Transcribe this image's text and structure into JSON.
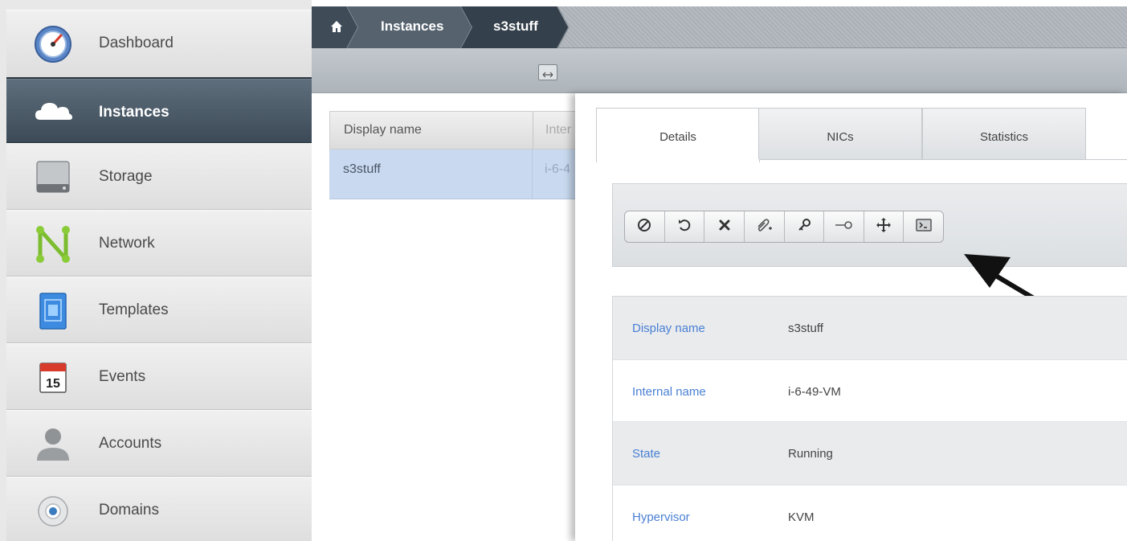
{
  "sidebar": {
    "items": [
      {
        "label": "Dashboard",
        "icon": "dashboard-gauge-icon",
        "active": false
      },
      {
        "label": "Instances",
        "icon": "cloud-icon",
        "active": true
      },
      {
        "label": "Storage",
        "icon": "hard-drive-icon",
        "active": false
      },
      {
        "label": "Network",
        "icon": "network-icon",
        "active": false
      },
      {
        "label": "Templates",
        "icon": "template-icon",
        "active": false
      },
      {
        "label": "Events",
        "icon": "calendar-icon",
        "active": false,
        "icon_text": "15"
      },
      {
        "label": "Accounts",
        "icon": "user-icon",
        "active": false
      },
      {
        "label": "Domains",
        "icon": "domain-icon",
        "active": false
      }
    ]
  },
  "breadcrumb": {
    "home_icon": "home-icon",
    "items": [
      "Instances",
      "s3stuff"
    ]
  },
  "list": {
    "columns": [
      "Display name",
      "Inter"
    ],
    "rows": [
      {
        "display_name": "s3stuff",
        "internal_name": "i-6-4"
      }
    ]
  },
  "detail": {
    "tabs": [
      "Details",
      "NICs",
      "Statistics"
    ],
    "active_tab": "Details",
    "actions": [
      {
        "name": "stop-icon"
      },
      {
        "name": "reboot-icon"
      },
      {
        "name": "destroy-icon"
      },
      {
        "name": "attach-iso-icon"
      },
      {
        "name": "reset-password-icon"
      },
      {
        "name": "change-service-offering-icon"
      },
      {
        "name": "migrate-icon"
      },
      {
        "name": "console-icon"
      }
    ],
    "fields": [
      {
        "label": "Display name",
        "value": "s3stuff"
      },
      {
        "label": "Internal name",
        "value": "i-6-49-VM"
      },
      {
        "label": "State",
        "value": "Running"
      },
      {
        "label": "Hypervisor",
        "value": "KVM"
      }
    ]
  },
  "colors": {
    "active_nav": "#4a5866",
    "link_blue": "#4a80d4",
    "selected_row": "#c9daf0"
  }
}
